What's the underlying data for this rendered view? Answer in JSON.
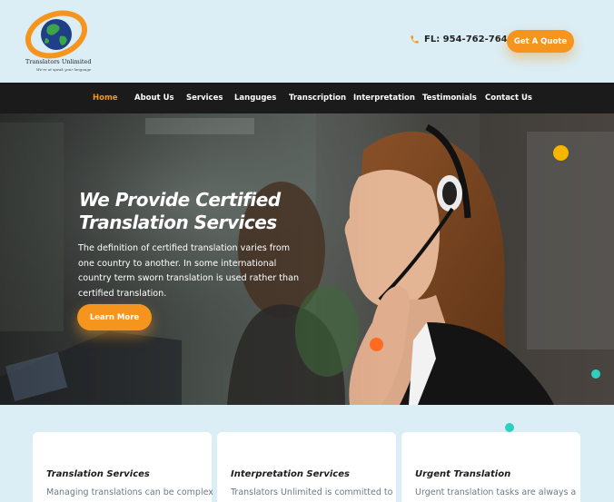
{
  "header": {
    "logo_name": "Translators Unlimited",
    "logo_tagline": "We're at speak your language",
    "phone": "FL: 954-762-7644",
    "quote_label": "Get A Quote"
  },
  "nav": {
    "items": [
      "Home",
      "About Us",
      "Services",
      "Languges",
      "Transcription",
      "Interpretation",
      "Testimonials",
      "Contact Us"
    ],
    "active": "Home"
  },
  "hero": {
    "title_line1": "We Provide Certified",
    "title_line2": "Translation Services",
    "description": "The definition of certified translation varies from one country to another.  In some international country term sworn translation is used rather than certified translation.",
    "button_label": "Learn More"
  },
  "cards": [
    {
      "title": "Translation Services",
      "text": "Managing translations can be complex"
    },
    {
      "title": "Interpretation Services",
      "text": "Translators Unlimited is committed to"
    },
    {
      "title": "Urgent Translation",
      "text": "Urgent translation tasks are always a"
    }
  ],
  "colors": {
    "accent": "#f5951e",
    "nav_bg": "#1b1b1b",
    "page_bg": "#dbeef6",
    "teal_dot": "#2ccfc0",
    "yellow_dot": "#f7b500"
  },
  "icons": {
    "phone": "phone-icon",
    "logo": "globe-icon"
  }
}
